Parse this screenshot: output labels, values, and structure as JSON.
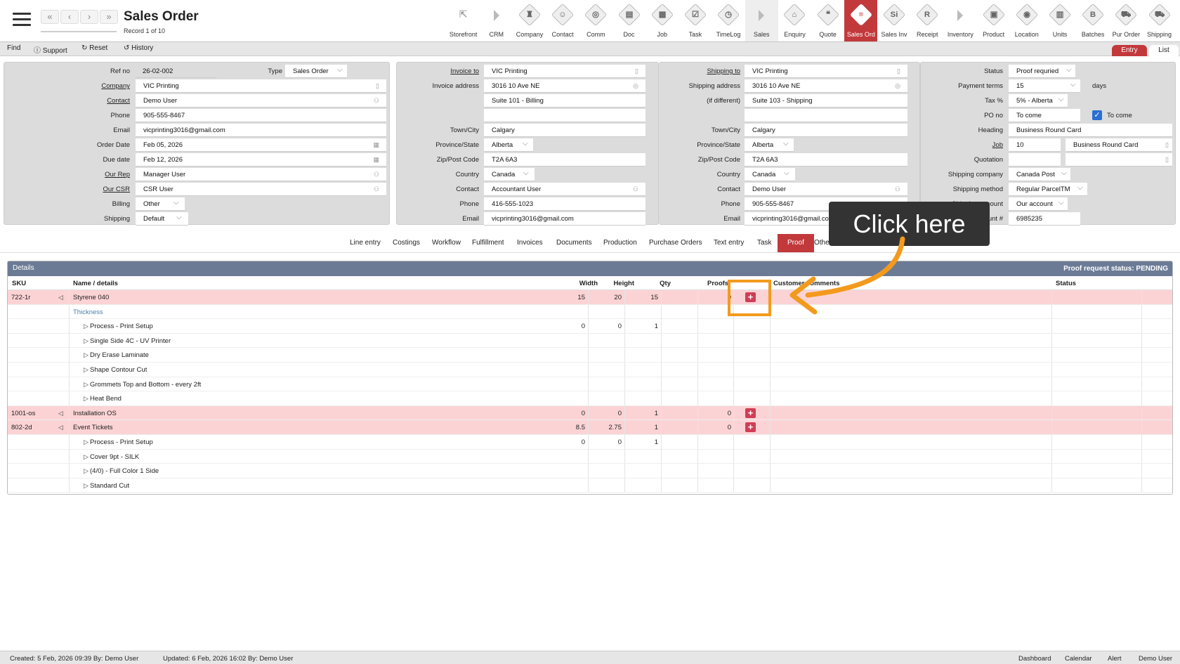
{
  "header": {
    "title": "Sales Order",
    "record": "Record 1 of 10"
  },
  "modules": [
    {
      "label": "Storefront",
      "icon": "external-link-icon",
      "kind": "plain"
    },
    {
      "label": "CRM",
      "icon": "arrow-right-icon",
      "kind": "arrow"
    },
    {
      "label": "Company",
      "glyph": "♜",
      "icon": "company-icon",
      "kind": "icon"
    },
    {
      "label": "Contact",
      "glyph": "☺",
      "icon": "contact-icon",
      "kind": "icon"
    },
    {
      "label": "Comm",
      "glyph": "◎",
      "icon": "comm-icon",
      "kind": "icon"
    },
    {
      "label": "Doc",
      "glyph": "▤",
      "icon": "doc-icon",
      "kind": "icon"
    },
    {
      "label": "Job",
      "glyph": "▦",
      "icon": "job-icon",
      "kind": "icon"
    },
    {
      "label": "Task",
      "glyph": "☑",
      "icon": "task-icon",
      "kind": "icon"
    },
    {
      "label": "TimeLog",
      "glyph": "◷",
      "icon": "timelog-icon",
      "kind": "icon"
    },
    {
      "label": "Sales",
      "icon": "arrow-right-icon",
      "kind": "arrow-grey"
    },
    {
      "label": "Enquiry",
      "glyph": "⌂",
      "icon": "enquiry-icon",
      "kind": "icon"
    },
    {
      "label": "Quote",
      "glyph": "❝",
      "icon": "quote-icon",
      "kind": "icon"
    },
    {
      "label": "Sales Ord",
      "glyph": "≡",
      "icon": "sales-order-icon",
      "kind": "active"
    },
    {
      "label": "Sales Inv",
      "glyph": "Si",
      "icon": "sales-invoice-icon",
      "kind": "icon"
    },
    {
      "label": "Receipt",
      "glyph": "R",
      "icon": "receipt-icon",
      "kind": "icon"
    },
    {
      "label": "Inventory",
      "icon": "arrow-right-icon",
      "kind": "arrow"
    },
    {
      "label": "Product",
      "glyph": "▣",
      "icon": "product-icon",
      "kind": "icon"
    },
    {
      "label": "Location",
      "glyph": "◉",
      "icon": "location-icon",
      "kind": "icon"
    },
    {
      "label": "Units",
      "glyph": "▥",
      "icon": "units-icon",
      "kind": "icon"
    },
    {
      "label": "Batches",
      "glyph": "B",
      "icon": "batches-icon",
      "kind": "icon"
    },
    {
      "label": "Pur Order",
      "glyph": "⛟",
      "icon": "purchase-order-icon",
      "kind": "icon"
    },
    {
      "label": "Shipping",
      "glyph": "⛟",
      "icon": "shipping-icon",
      "kind": "icon"
    }
  ],
  "toolbar": {
    "find": "Find",
    "support": "Support",
    "reset": "Reset",
    "history": "History",
    "entry": "Entry",
    "list": "List"
  },
  "panel1": {
    "refno_label": "Ref no",
    "refno": "26-02-002",
    "type_label": "Type",
    "type": "Sales Order",
    "company_label": "Company",
    "company": "VIC Printing",
    "contact_label": "Contact",
    "contact": "Demo User",
    "phone_label": "Phone",
    "phone": "905-555-8467",
    "email_label": "Email",
    "email": "vicprinting3016@gmail.com",
    "orderdate_label": "Order Date",
    "orderdate": "Feb 05, 2026",
    "duedate_label": "Due date",
    "duedate": "Feb 12, 2026",
    "rep_label": "Our Rep",
    "rep": "Manager User",
    "csr_label": "Our CSR",
    "csr": "CSR User",
    "billing_label": "Billing",
    "billing": "Other",
    "shipping_label": "Shipping",
    "shipping": "Default"
  },
  "panel2": {
    "invoiceto_label": "Invoice to",
    "invoiceto": "VIC Printing",
    "addr_label": "Invoice address",
    "addr1": "3016 10 Ave NE",
    "addr2": "Suite 101 - Billing",
    "town_label": "Town/City",
    "town": "Calgary",
    "prov_label": "Province/State",
    "prov": "Alberta",
    "zip_label": "Zip/Post Code",
    "zip": "T2A 6A3",
    "country_label": "Country",
    "country": "Canada",
    "contact_label": "Contact",
    "contact": "Accountant User",
    "phone_label": "Phone",
    "phone": "416-555-1023",
    "email_label": "Email",
    "email": "vicprinting3016@gmail.com"
  },
  "panel3": {
    "shipto_label": "Shipping to",
    "shipto": "VIC Printing",
    "addr_label": "Shipping address",
    "addr_label2": "(if different)",
    "addr1": "3016 10 Ave NE",
    "addr2": "Suite 103 - Shipping",
    "town_label": "Town/City",
    "town": "Calgary",
    "prov_label": "Province/State",
    "prov": "Alberta",
    "zip_label": "Zip/Post Code",
    "zip": "T2A 6A3",
    "country_label": "Country",
    "country": "Canada",
    "contact_label": "Contact",
    "contact": "Demo User",
    "phone_label": "Phone",
    "phone": "905-555-8467",
    "email_label": "Email",
    "email": "vicprinting3016@gmail.com"
  },
  "panel4": {
    "status_label": "Status",
    "status": "Proof requried",
    "terms_label": "Payment terms",
    "terms": "15",
    "terms_unit": "days",
    "tax_label": "Tax %",
    "tax": "5% - Alberta",
    "po_label": "PO no",
    "po": "To come",
    "po_check": "To come",
    "heading_label": "Heading",
    "heading": "Business Round Card",
    "job_label": "Job",
    "job": "10",
    "job_desc": "Business Round Card",
    "quotation_label": "Quotation",
    "shipco_label": "Shipping company",
    "shipco": "Canada Post",
    "shipmethod_label": "Shipping method",
    "shipmethod": "Regular ParcelTM",
    "shipacct_label": "Shipping account",
    "shipacct": "Our account",
    "account_label": "Account #",
    "account": "6985235"
  },
  "tabs": [
    "Line entry",
    "Costings",
    "Workflow",
    "Fulfillment",
    "Invoices",
    "Documents",
    "Production",
    "Purchase Orders",
    "Text entry",
    "Task",
    "Proof",
    "Other"
  ],
  "grid": {
    "title": "Details",
    "request_status": "Proof request status: PENDING",
    "columns": {
      "sku": "SKU",
      "name": "Name / details",
      "width": "Width",
      "height": "Height",
      "qty": "Qty",
      "proofs": "Proofs",
      "comments": "Customer comments",
      "status": "Status"
    },
    "rows": [
      {
        "sku": "722-1r",
        "name": "Styrene 040",
        "width": "15",
        "height": "20",
        "qty": "15",
        "proofs": "0",
        "kind": "item"
      },
      {
        "name": "Thickness",
        "kind": "group"
      },
      {
        "name": "Process - Print Setup",
        "width": "0",
        "height": "0",
        "qty": "1",
        "kind": "sub"
      },
      {
        "name": "Single Side 4C - UV Printer",
        "kind": "sub"
      },
      {
        "name": "Dry Erase Laminate",
        "kind": "sub"
      },
      {
        "name": "Shape Contour Cut",
        "kind": "sub"
      },
      {
        "name": "Grommets Top and Bottom - every 2ft",
        "kind": "sub"
      },
      {
        "name": "Heat Bend",
        "kind": "sub"
      },
      {
        "sku": "1001-os",
        "name": "Installation OS",
        "width": "0",
        "height": "0",
        "qty": "1",
        "proofs": "0",
        "kind": "item"
      },
      {
        "sku": "802-2d",
        "name": "Event Tickets",
        "width": "8.5",
        "height": "2.75",
        "qty": "1",
        "proofs": "0",
        "kind": "item"
      },
      {
        "name": "Process - Print Setup",
        "width": "0",
        "height": "0",
        "qty": "1",
        "kind": "sub"
      },
      {
        "name": "Cover 9pt - SILK",
        "kind": "sub"
      },
      {
        "name": "(4/0) - Full Color 1 Side",
        "kind": "sub"
      },
      {
        "name": "Standard Cut",
        "kind": "sub"
      }
    ]
  },
  "footer": {
    "created": "Created: 5 Feb, 2026   09:39   By: Demo User",
    "updated": "Updated: 6 Feb, 2026   16:02   By: Demo User",
    "dashboard": "Dashboard",
    "calendar": "Calendar",
    "alert": "Alert",
    "user": "Demo User"
  },
  "callout": {
    "text": "Click here"
  },
  "colors": {
    "accent": "#c2393c",
    "highlight": "#f39a1d",
    "grid_header": "#6b7b96",
    "pink_row": "#fcd3d5"
  }
}
